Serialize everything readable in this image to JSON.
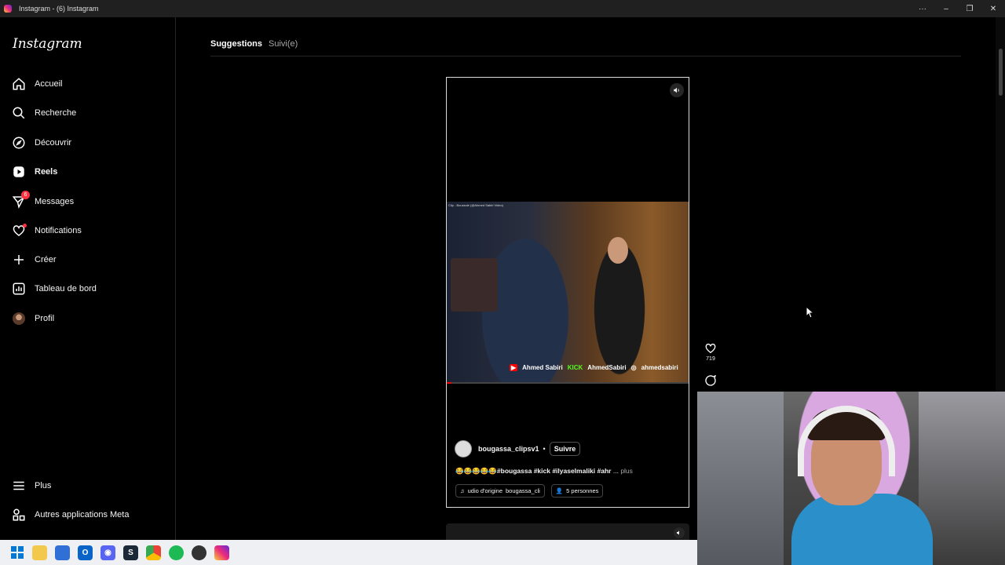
{
  "window": {
    "title": "Instagram - (6) Instagram"
  },
  "sidebar": {
    "logo": "Instagram",
    "items": [
      {
        "label": "Accueil",
        "icon": "home-icon"
      },
      {
        "label": "Recherche",
        "icon": "search-icon"
      },
      {
        "label": "Découvrir",
        "icon": "compass-icon"
      },
      {
        "label": "Reels",
        "icon": "reels-icon",
        "active": true
      },
      {
        "label": "Messages",
        "icon": "messenger-icon",
        "badge": "6"
      },
      {
        "label": "Notifications",
        "icon": "heart-icon"
      },
      {
        "label": "Créer",
        "icon": "plus-icon"
      },
      {
        "label": "Tableau de bord",
        "icon": "dashboard-icon"
      },
      {
        "label": "Profil",
        "icon": "avatar"
      }
    ],
    "bottom": [
      {
        "label": "Plus",
        "icon": "menu-icon"
      },
      {
        "label": "Autres applications Meta",
        "icon": "meta-apps-icon"
      }
    ]
  },
  "tabs": {
    "suggestions": "Suggestions",
    "following": "Suivi(e)"
  },
  "reel": {
    "video_caption": "Clip - Boussole (@Ahmed Sabiri Video)",
    "banner": {
      "youtube": "Ahmed Sabiri",
      "kick_tag": "KICK",
      "kick": "AhmedSabiri",
      "instagram": "ahmedsabiri"
    },
    "progress": 0.02,
    "author": "bougassa_clipsv1",
    "separator": "•",
    "follow": "Suivre",
    "caption_emojis": "😂😂😂😂😂",
    "caption_tags": "#bougassa #kick #ilyaselmaliki #ahr",
    "caption_more_dots": "...",
    "caption_more": "plus",
    "audio": "udio d'origine",
    "audio_author": "bougassa_cli",
    "people": "5 personnes"
  },
  "actions": {
    "likes": "719"
  },
  "colors": {
    "accent": "#ff3040",
    "border": "#262626",
    "background": "#000000"
  }
}
